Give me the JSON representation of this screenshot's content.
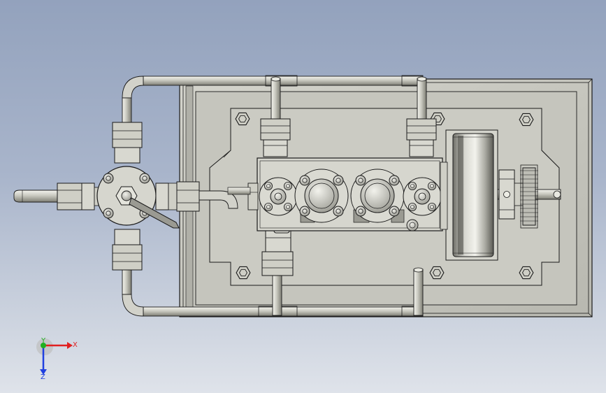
{
  "viewport": {
    "background_top": "#93a2bd",
    "background_bottom": "#dfe3ea",
    "part_color": "#c8c8c0",
    "edge_color": "#1a1a1a"
  },
  "triad": {
    "x_label": "X",
    "y_label": "Y",
    "z_label": "Z",
    "x_color": "#e02020",
    "y_color": "#20b020",
    "z_color": "#2040e0"
  }
}
